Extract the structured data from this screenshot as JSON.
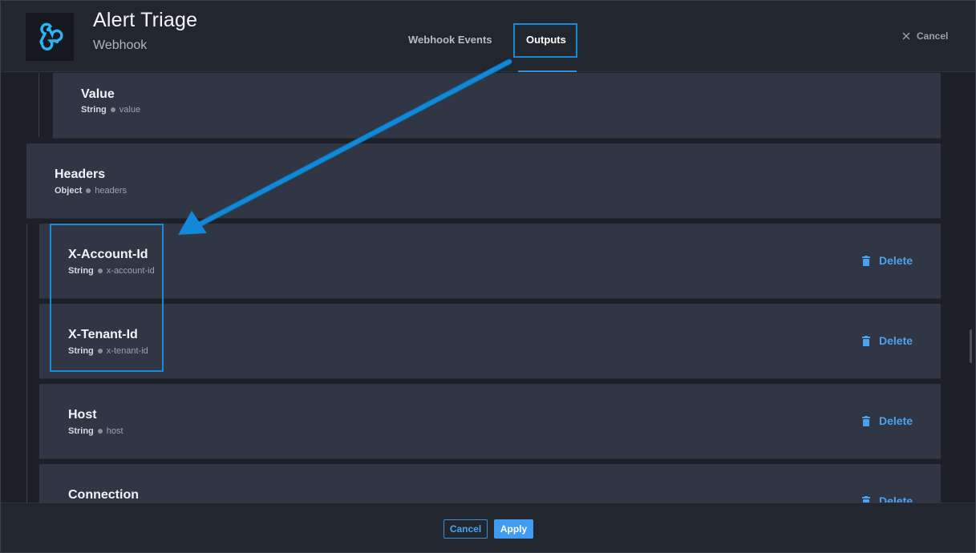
{
  "header": {
    "title": "Alert Triage",
    "subtitle": "Webhook",
    "tabs": [
      {
        "label": "Webhook Events"
      },
      {
        "label": "Outputs"
      }
    ],
    "cancel_label": "Cancel",
    "logo_icon": "webhook-icon",
    "accent_color": "#1b8ad2"
  },
  "outputs": {
    "value": {
      "name": "Value",
      "type": "String",
      "key": "value"
    },
    "headers": {
      "name": "Headers",
      "type": "Object",
      "key": "headers"
    },
    "items": [
      {
        "name": "X-Account-Id",
        "type": "String",
        "key": "x-account-id",
        "delete_label": "Delete"
      },
      {
        "name": "X-Tenant-Id",
        "type": "String",
        "key": "x-tenant-id",
        "delete_label": "Delete"
      },
      {
        "name": "Host",
        "type": "String",
        "key": "host",
        "delete_label": "Delete"
      },
      {
        "name": "Connection",
        "type": "",
        "key": "",
        "delete_label": "Delete"
      }
    ]
  },
  "footer": {
    "cancel_label": "Cancel",
    "apply_label": "Apply"
  }
}
